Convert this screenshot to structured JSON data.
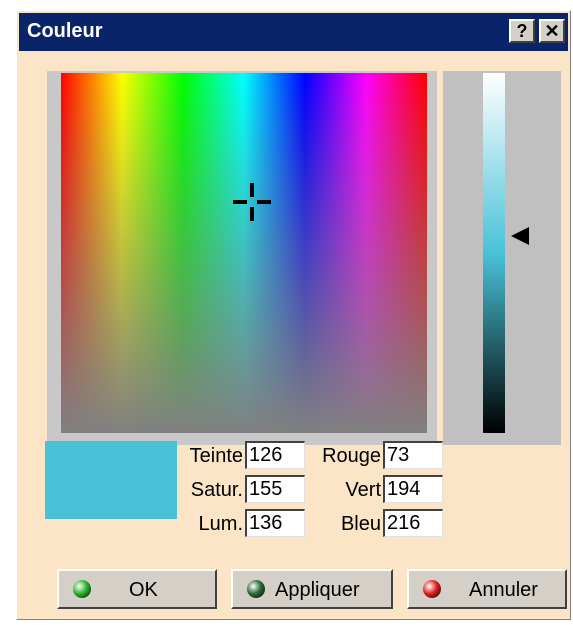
{
  "window": {
    "title": "Couleur",
    "help_label": "?",
    "close_label": "✕"
  },
  "color": {
    "swatch": "#49c2d8",
    "hue_label": "Teinte",
    "hue_value": "126",
    "sat_label": "Satur.",
    "sat_value": "155",
    "lum_label": "Lum.",
    "lum_value": "136",
    "red_label": "Rouge",
    "red_value": "73",
    "green_label": "Vert",
    "green_value": "194",
    "blue_label": "Bleu",
    "blue_value": "216"
  },
  "buttons": {
    "ok_label": "OK",
    "ok_icon": "green-led-icon",
    "ok_icon_color": "#2db52d",
    "apply_label": "Appliquer",
    "apply_icon": "dark-green-led-icon",
    "apply_icon_color": "#2e6b3a",
    "cancel_label": "Annuler",
    "cancel_icon": "red-led-icon",
    "cancel_icon_color": "#e02020"
  }
}
